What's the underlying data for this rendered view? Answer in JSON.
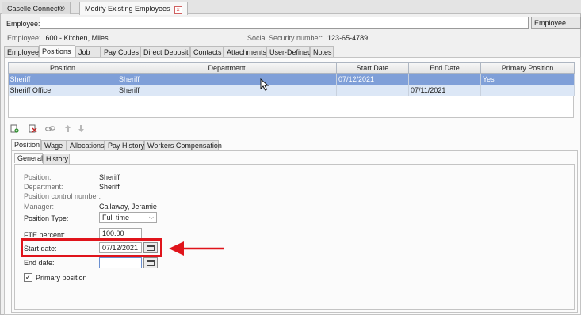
{
  "tabs": [
    {
      "label": "Caselle Connect®"
    },
    {
      "label": "Modify Existing Employees",
      "close": "×"
    }
  ],
  "employee_bar": {
    "label": "Employee:",
    "value": "",
    "button_label": "Employee"
  },
  "info": {
    "employee_label": "Employee:",
    "employee_value": "600 - Kitchen, Miles",
    "ssn_label": "Social Security number:",
    "ssn_value": "123-65-4789"
  },
  "section_tabs": [
    "Employee",
    "Positions",
    "Job",
    "Pay Codes",
    "Direct Deposit",
    "Contacts",
    "Attachments",
    "User-Defined",
    "Notes"
  ],
  "grid": {
    "columns": [
      "Position",
      "Department",
      "Start Date",
      "End Date",
      "Primary Position"
    ],
    "rows": [
      [
        "Sheriff",
        "Sheriff",
        "07/12/2021",
        "",
        "Yes"
      ],
      [
        "Sheriff Office",
        "Sheriff",
        "",
        "07/11/2021",
        ""
      ]
    ]
  },
  "toolbar_icons": [
    "add-icon",
    "delete-icon",
    "link-icon",
    "move-up-icon",
    "move-down-icon"
  ],
  "detail_tabs": [
    "Position",
    "Wage",
    "Allocations",
    "Pay History",
    "Workers Compensation"
  ],
  "sub_tabs": [
    "General",
    "History"
  ],
  "form": {
    "position_label": "Position:",
    "position_value": "Sheriff",
    "department_label": "Department:",
    "department_value": "Sheriff",
    "control_label": "Position control number:",
    "control_value": "",
    "manager_label": "Manager:",
    "manager_value": "Callaway, Jeramie",
    "type_label": "Position Type:",
    "type_value": "Full time",
    "fte_label": "FTE percent:",
    "fte_value": "100.00",
    "start_label": "Start date:",
    "start_value": "07/12/2021",
    "end_label": "End date:",
    "end_value": "",
    "primary_label": "Primary position",
    "primary_checked": true
  },
  "annotation_color": "#e0141b"
}
